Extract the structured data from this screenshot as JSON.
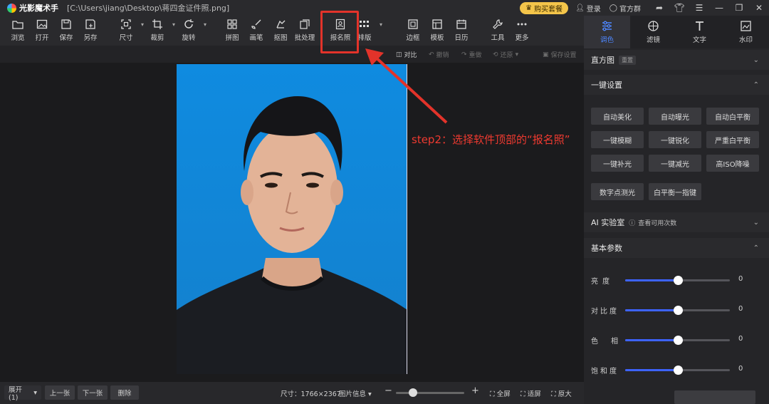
{
  "titlebar": {
    "app_name": "光影魔术手",
    "file_path": "[C:\\Users\\jiang\\Desktop\\蒋四金证件照.png]",
    "buy_label": "购买套餐",
    "login_label": "登录",
    "group_label": "官方群"
  },
  "toolbar": {
    "tools": [
      {
        "label": "浏览",
        "icon": "folder-icon"
      },
      {
        "label": "打开",
        "icon": "image-open-icon"
      },
      {
        "label": "保存",
        "icon": "save-icon"
      },
      {
        "label": "另存",
        "icon": "save-as-icon"
      },
      {
        "label": "尺寸",
        "icon": "resize-icon"
      },
      {
        "label": "裁剪",
        "icon": "crop-icon"
      },
      {
        "label": "旋转",
        "icon": "rotate-icon"
      },
      {
        "label": "拼图",
        "icon": "collage-icon"
      },
      {
        "label": "画笔",
        "icon": "brush-icon"
      },
      {
        "label": "抠图",
        "icon": "cutout-icon"
      },
      {
        "label": "批处理",
        "icon": "batch-icon"
      },
      {
        "label": "报名照",
        "icon": "id-photo-icon"
      },
      {
        "label": "排版",
        "icon": "layout-icon"
      },
      {
        "label": "边框",
        "icon": "border-icon"
      },
      {
        "label": "模板",
        "icon": "template-icon"
      },
      {
        "label": "日历",
        "icon": "calendar-icon"
      },
      {
        "label": "工具",
        "icon": "wrench-icon"
      },
      {
        "label": "更多",
        "icon": "more-icon"
      }
    ]
  },
  "subbar": {
    "compare": "对比",
    "undo": "撤销",
    "redo": "重做",
    "restore": "还原",
    "save_settings": "保存设置"
  },
  "annotation": {
    "step_text": "step2：选择软件顶部的“报名照”",
    "color": "#e3332a"
  },
  "bottombar": {
    "expand": "展开(1)",
    "prev": "上一张",
    "next": "下一张",
    "delete": "删除",
    "size_label": "尺寸：",
    "size_value": "1766×2367",
    "image_info": "图片信息",
    "zoom_percent": 25,
    "fullscreen": "全屏",
    "fit": "适屏",
    "original": "原大"
  },
  "rightpanel": {
    "tabs": [
      {
        "label": "调色",
        "icon": "sliders-icon",
        "active": true
      },
      {
        "label": "滤镜",
        "icon": "filter-icon",
        "active": false
      },
      {
        "label": "文字",
        "icon": "text-icon",
        "active": false
      },
      {
        "label": "水印",
        "icon": "watermark-icon",
        "active": false
      }
    ],
    "histogram": {
      "title": "直方图",
      "tag": "重置"
    },
    "one_key": {
      "title": "一键设置",
      "buttons": [
        "自动美化",
        "自动曝光",
        "自动白平衡",
        "一键模糊",
        "一键锐化",
        "严重白平衡",
        "一键补光",
        "一键减光",
        "高ISO降噪",
        "数字点测光",
        "白平衡一指键"
      ]
    },
    "ai_lab": {
      "title": "AI 实验室",
      "hint": "查看可用次数"
    },
    "basic": {
      "title": "基本参数",
      "sliders": [
        {
          "label": "亮度",
          "value": "0",
          "level": 0.5
        },
        {
          "label": "对比度",
          "value": "0",
          "level": 0.5
        },
        {
          "label": "色相",
          "value": "0",
          "level": 0.5
        },
        {
          "label": "饱和度",
          "value": "0",
          "level": 0.5
        }
      ]
    },
    "accent": "#3d63ff"
  }
}
